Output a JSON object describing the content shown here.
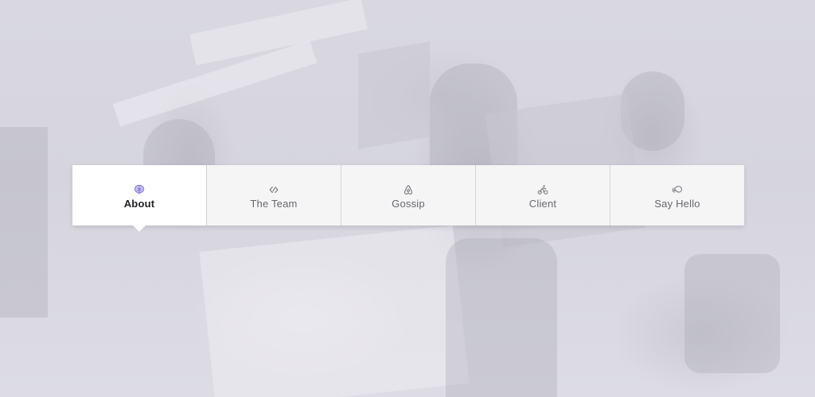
{
  "colors": {
    "accent": "#7b6fd6",
    "tab_background": "#f5f5f5",
    "active_tab_background": "#ffffff",
    "label_color": "#666670",
    "active_label_color": "#222226"
  },
  "tabs": [
    {
      "label": "About",
      "icon": "brain-icon",
      "active": true
    },
    {
      "label": "The Team",
      "icon": "code-brackets-icon",
      "active": false
    },
    {
      "label": "Gossip",
      "icon": "airbnb-icon",
      "active": false
    },
    {
      "label": "Client",
      "icon": "cyclist-icon",
      "active": false
    },
    {
      "label": "Say Hello",
      "icon": "infinity-cloud-icon",
      "active": false
    }
  ]
}
